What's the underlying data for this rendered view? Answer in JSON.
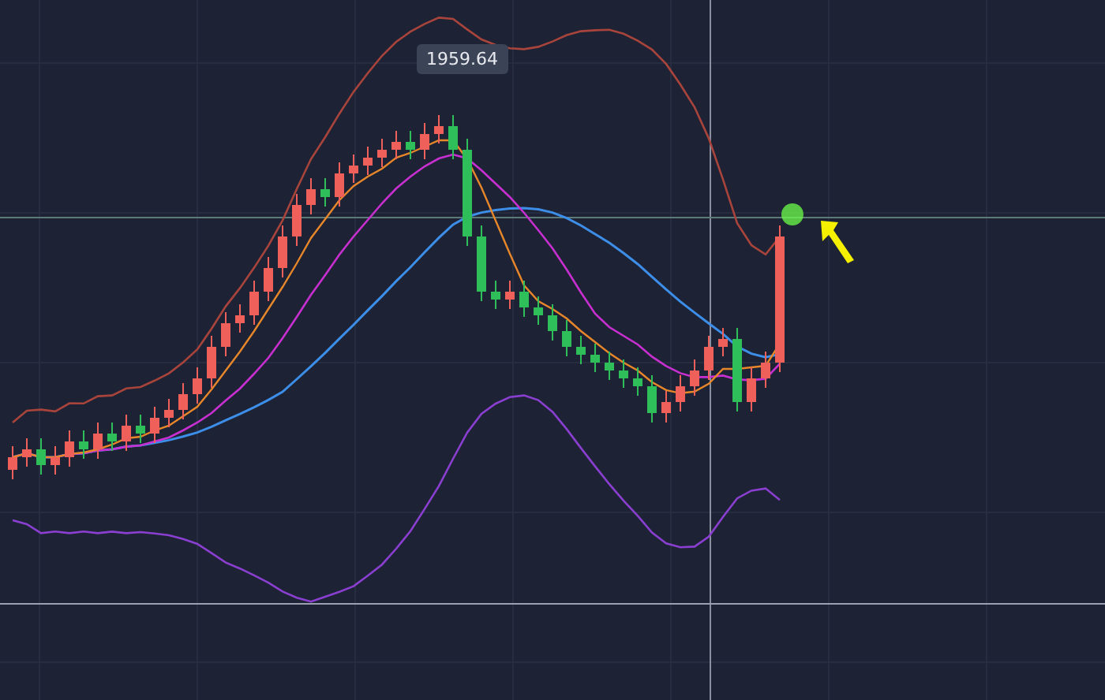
{
  "chart": {
    "price_label": "1959.64"
  }
}
